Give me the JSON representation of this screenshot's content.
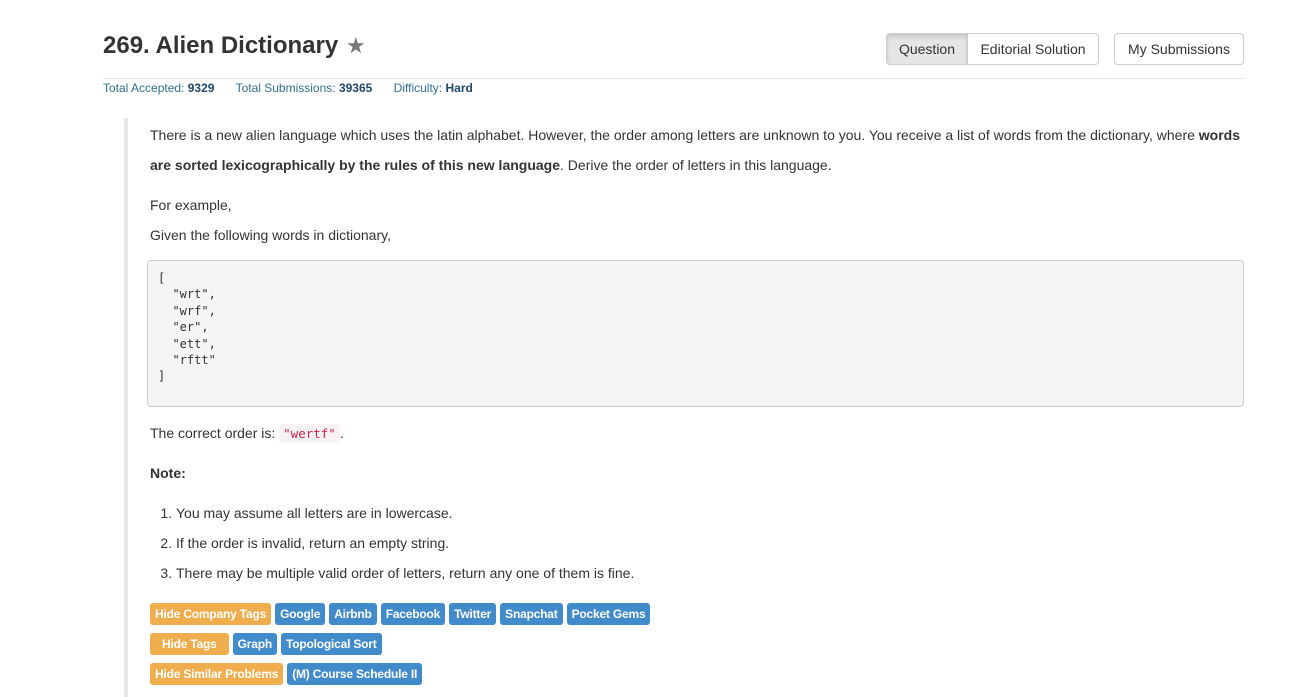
{
  "header": {
    "title": "269. Alien Dictionary",
    "star_icon": "★",
    "buttons": {
      "question": "Question",
      "editorial": "Editorial Solution",
      "submissions": "My Submissions"
    }
  },
  "stats": {
    "accepted_label": "Total Accepted:",
    "accepted_value": "9329",
    "submissions_label": "Total Submissions:",
    "submissions_value": "39365",
    "difficulty_label": "Difficulty:",
    "difficulty_value": "Hard"
  },
  "description": {
    "line1_text": "There is a new alien language which uses the latin alphabet. However, the order among letters are unknown to you. You receive a list of words from the dictionary, where ",
    "line1_bold": "words",
    "line2_bold": "are sorted lexicographically by the rules of this new language",
    "line2_text": ". Derive the order of letters in this language.",
    "for_example": "For example,",
    "given": "Given the following words in dictionary,",
    "code": "[\n  \"wrt\",\n  \"wrf\",\n  \"er\",\n  \"ett\",\n  \"rftt\"\n]",
    "order_prefix": "The correct order is: ",
    "order_value": "\"wertf\"",
    "order_suffix": ".",
    "note_label": "Note:",
    "notes": [
      "You may assume all letters are in lowercase.",
      "If the order is invalid, return an empty string.",
      "There may be multiple valid order of letters, return any one of them is fine."
    ]
  },
  "tags": {
    "company_toggle": "Hide Company Tags",
    "companies": [
      "Google",
      "Airbnb",
      "Facebook",
      "Twitter",
      "Snapchat",
      "Pocket Gems"
    ],
    "tags_toggle": "Hide Tags",
    "topics": [
      "Graph",
      "Topological Sort"
    ],
    "similar_toggle": "Hide Similar Problems",
    "similar": [
      "(M) Course Schedule II"
    ]
  },
  "colors": {
    "orange": "#f0ad4e",
    "blue": "#428bca",
    "link": "#31708f"
  }
}
